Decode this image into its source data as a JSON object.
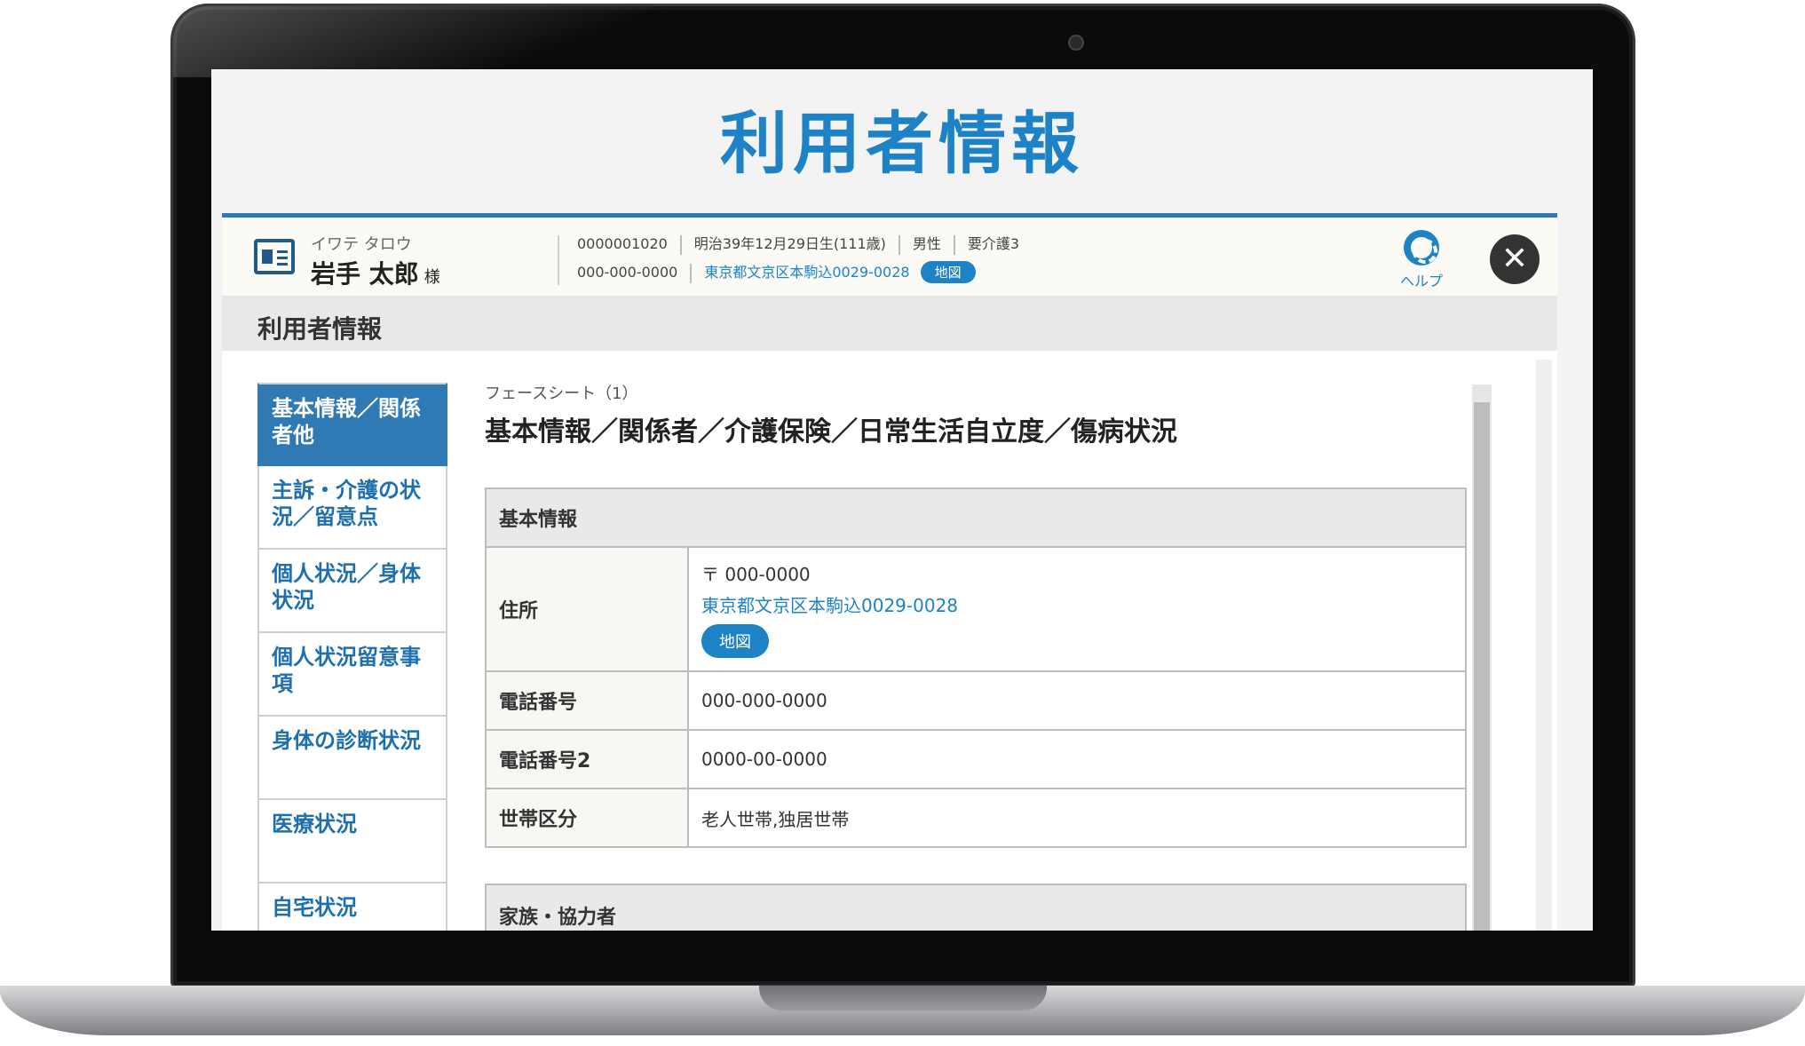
{
  "hero_title": "利用者情報",
  "user": {
    "kana": "イワテ タロウ",
    "name": "岩手 太郎",
    "honorific": "様",
    "id": "0000001020",
    "birth": "明治39年12月29日生(111歳)",
    "sex": "男性",
    "care_level": "要介護3",
    "phone": "000-000-0000",
    "address": "東京都文京区本駒込0029-0028",
    "map_label": "地図"
  },
  "help_label": "ヘルプ",
  "close_label": "✕",
  "section_title": "利用者情報",
  "nav": [
    {
      "label": "基本情報／関係者他",
      "active": true
    },
    {
      "label": "主訴・介護の状況／留意点",
      "active": false
    },
    {
      "label": "個人状況／身体状況",
      "active": false
    },
    {
      "label": "個人状況留意事項",
      "active": false
    },
    {
      "label": "身体の診断状況",
      "active": false
    },
    {
      "label": "医療状況",
      "active": false
    },
    {
      "label": "自宅状況",
      "active": false
    }
  ],
  "sheet": {
    "label": "フェースシート（1）",
    "title": "基本情報／関係者／介護保険／日常生活自立度／傷病状況"
  },
  "basic_info": {
    "header": "基本情報",
    "address_label": "住所",
    "postal": "〒 000-0000",
    "address": "東京都文京区本駒込0029-0028",
    "map_label": "地図",
    "phone_label": "電話番号",
    "phone": "000-000-0000",
    "phone2_label": "電話番号2",
    "phone2": "0000-00-0000",
    "household_label": "世帯区分",
    "household": "老人世帯,独居世帯"
  },
  "family_header": "家族・協力者"
}
